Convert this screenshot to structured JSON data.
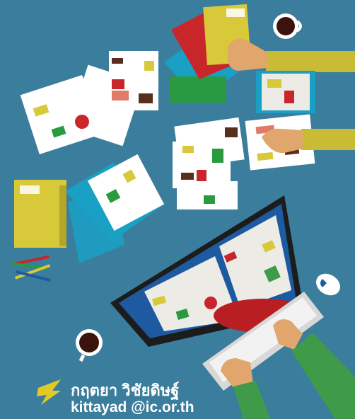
{
  "credit": {
    "author_name": "กฤตยา วิชัยดิษฐ์",
    "author_email": "kittayad @ic.or.th"
  },
  "colors": {
    "background": "#3b7d9c",
    "accent_yellow": "#d7c93a",
    "monitor_blue": "#1d5aa0",
    "sleeve_green": "#3f9a4a"
  },
  "icons": [
    "coffee-cup-icon",
    "mouse-icon",
    "pencils-icon",
    "keyboard-icon",
    "lightning-bolt-icon"
  ]
}
